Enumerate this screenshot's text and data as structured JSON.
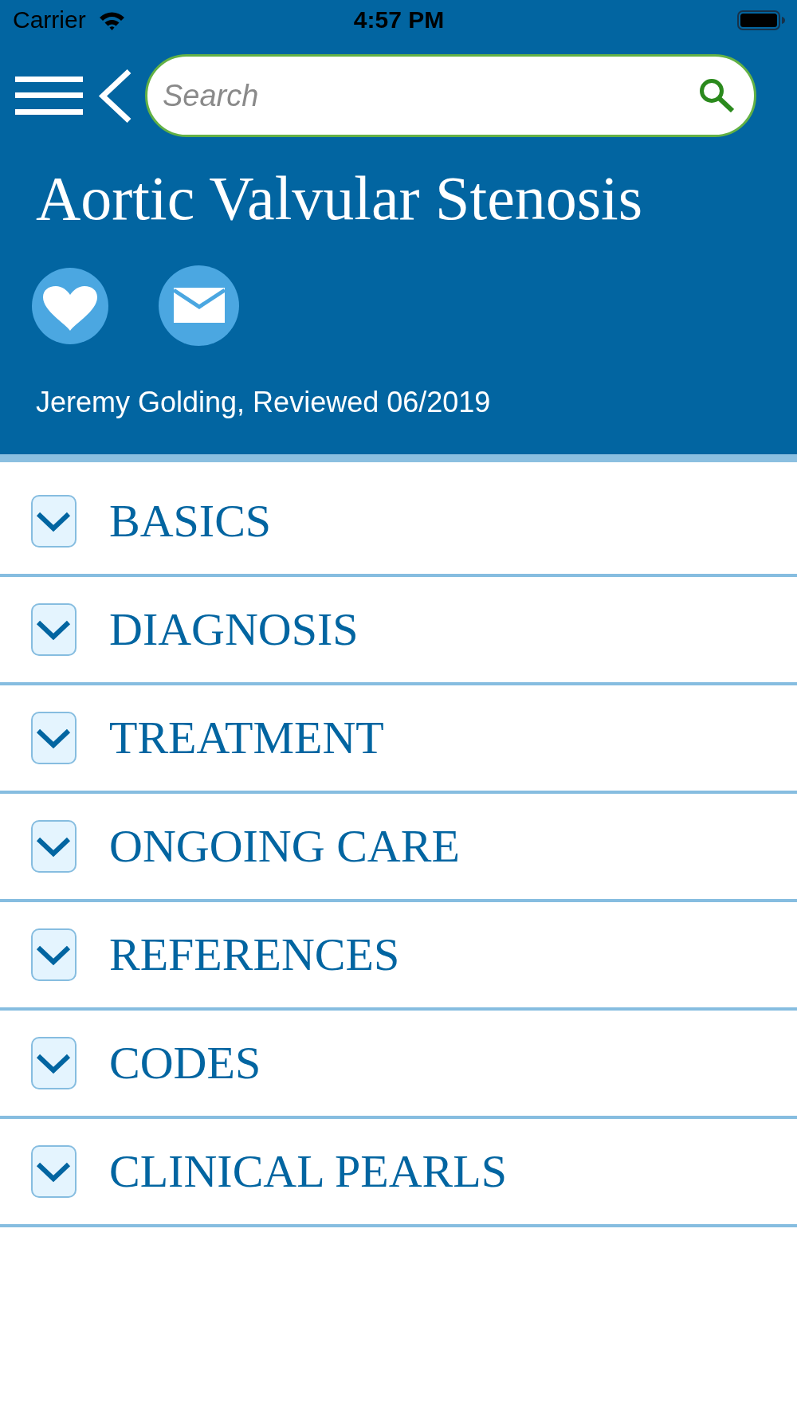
{
  "status_bar": {
    "carrier": "Carrier",
    "time": "4:57 PM"
  },
  "toolbar": {
    "search": {
      "placeholder": "Search"
    }
  },
  "article": {
    "title": "Aortic Valvular Stenosis",
    "byline": "Jeremy Golding, Reviewed 06/2019"
  },
  "sections": [
    {
      "label": "BASICS",
      "expanded": false
    },
    {
      "label": "DIAGNOSIS",
      "expanded": false
    },
    {
      "label": "TREATMENT",
      "expanded": false
    },
    {
      "label": "ONGOING CARE",
      "expanded": false
    },
    {
      "label": "REFERENCES",
      "expanded": false
    },
    {
      "label": "CODES",
      "expanded": false
    },
    {
      "label": "CLINICAL PEARLS",
      "expanded": false
    }
  ]
}
